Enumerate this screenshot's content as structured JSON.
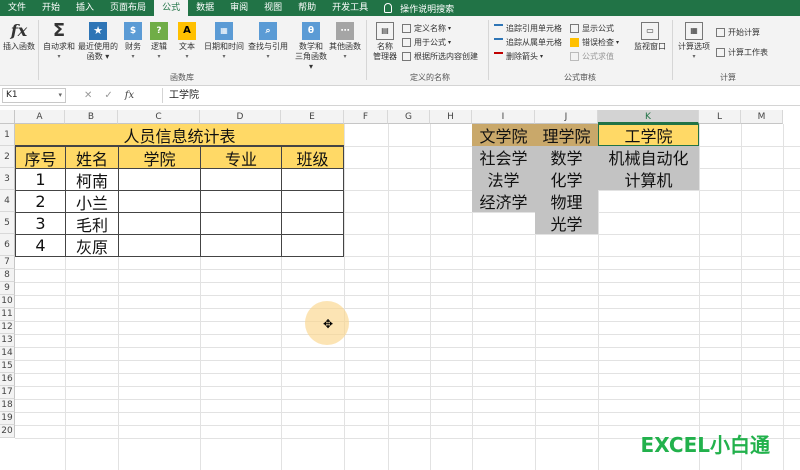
{
  "menu": {
    "items": [
      "文件",
      "开始",
      "插入",
      "页面布局",
      "公式",
      "数据",
      "审阅",
      "视图",
      "帮助",
      "开发工具"
    ],
    "active_index": 4,
    "tell_me": "操作说明搜索"
  },
  "ribbon": {
    "function_library": {
      "insert_function": "插入函数",
      "autosum": "自动求和",
      "recent": "最近使用的\n函数",
      "financial": "财务",
      "logical": "逻辑",
      "text": "文本",
      "datetime": "日期和时间",
      "lookup": "查找与引用",
      "math": "数学和\n三角函数",
      "more": "其他函数",
      "group_label": "函数库"
    },
    "defined_names": {
      "name_manager": "名称\n管理器",
      "define_name": "定义名称",
      "use_in_formula": "用于公式",
      "create_from_selection": "根据所选内容创建",
      "group_label": "定义的名称"
    },
    "formula_auditing": {
      "trace_precedents": "追踪引用单元格",
      "trace_dependents": "追踪从属单元格",
      "remove_arrows": "删除箭头",
      "show_formulas": "显示公式",
      "error_checking": "错误检查",
      "evaluate_formula": "公式求值",
      "watch_window": "监视窗口",
      "group_label": "公式审核"
    },
    "calculation": {
      "options": "计算选项",
      "calc_now": "开始计算",
      "calc_sheet": "计算工作表",
      "group_label": "计算"
    }
  },
  "formula_bar": {
    "name_box": "K1",
    "fx": "fx",
    "value": "工学院"
  },
  "columns": [
    "A",
    "B",
    "C",
    "D",
    "E",
    "F",
    "G",
    "H",
    "I",
    "J",
    "K",
    "L",
    "M"
  ],
  "rows": [
    "1",
    "2",
    "3",
    "4",
    "5",
    "6",
    "7",
    "8",
    "9",
    "10",
    "11",
    "12",
    "13",
    "14",
    "15",
    "16",
    "17",
    "18",
    "19",
    "20"
  ],
  "table": {
    "title": "人员信息统计表",
    "headers": [
      "序号",
      "姓名",
      "学院",
      "专业",
      "班级"
    ],
    "rows": [
      [
        "1",
        "柯南",
        "",
        "",
        ""
      ],
      [
        "2",
        "小兰",
        "",
        "",
        ""
      ],
      [
        "3",
        "毛利",
        "",
        "",
        ""
      ],
      [
        "4",
        "灰原",
        "",
        "",
        ""
      ]
    ]
  },
  "colleges": {
    "I": [
      "文学院",
      "社会学",
      "法学",
      "经济学"
    ],
    "J": [
      "理学院",
      "数学",
      "化学",
      "物理",
      "光学"
    ],
    "K": [
      "工学院",
      "机械自动化",
      "计算机"
    ]
  },
  "watermark": "EXCEL小白通",
  "colors": {
    "excel_green": "#217346",
    "header_yellow": "#ffd966",
    "gold": "#c9a86a",
    "gray": "#c3c3c3",
    "watermark_green": "#22b14c"
  }
}
